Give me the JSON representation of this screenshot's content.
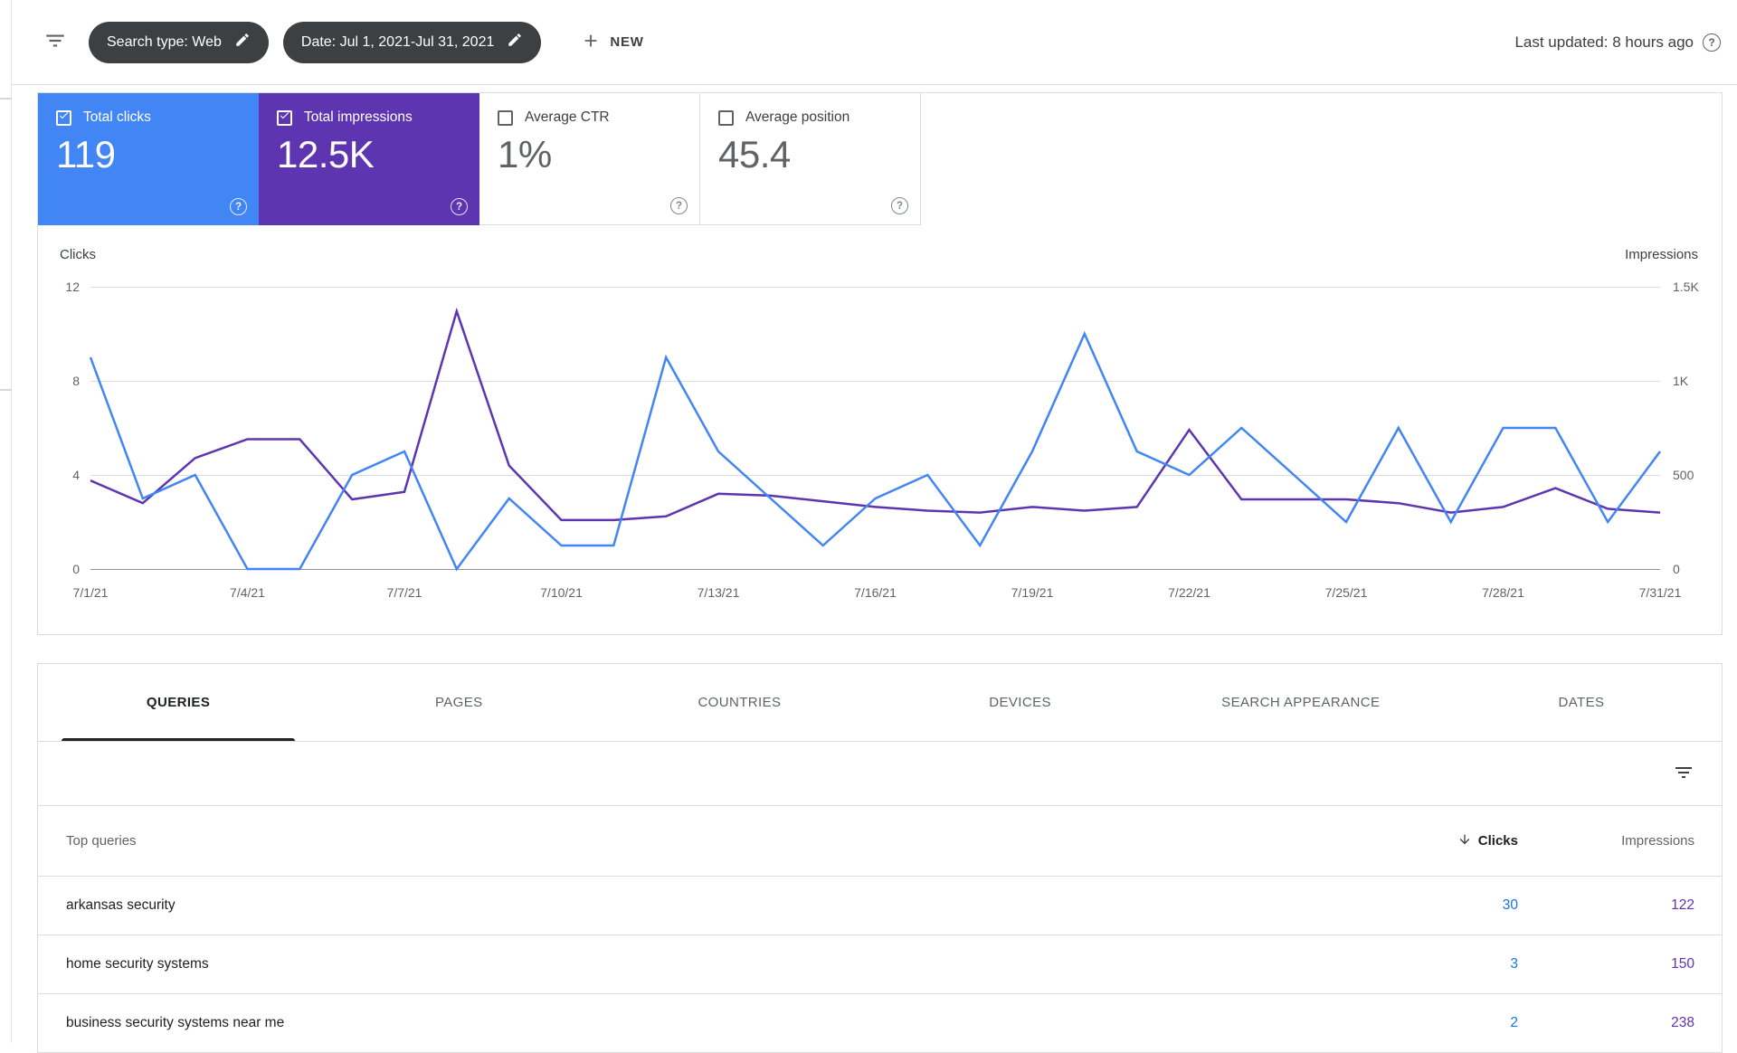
{
  "topbar": {
    "search_type_chip": "Search type: Web",
    "date_chip": "Date: Jul 1, 2021-Jul 31, 2021",
    "new_button_label": "NEW",
    "last_updated": "Last updated: 8 hours ago"
  },
  "icons": {
    "help_glyph": "?",
    "filter": "filter-list-icon",
    "edit": "pencil-icon",
    "add": "plus-icon",
    "sort": "arrow-down-icon",
    "checked": "checkmark-icon"
  },
  "colors": {
    "clicks_blue": "#4285f4",
    "impressions_purple": "#5e35b1",
    "link_blue": "#1a73e8",
    "chip_background": "#3c4043",
    "border_gray": "#dadce0"
  },
  "metric_cards": [
    {
      "label": "Total clicks",
      "value": "119",
      "selected": true
    },
    {
      "label": "Total impressions",
      "value": "12.5K",
      "selected": true
    },
    {
      "label": "Average CTR",
      "value": "1%",
      "selected": false
    },
    {
      "label": "Average position",
      "value": "45.4",
      "selected": false
    }
  ],
  "chart_data": {
    "type": "line",
    "x": [
      "7/1/21",
      "7/2/21",
      "7/3/21",
      "7/4/21",
      "7/5/21",
      "7/6/21",
      "7/7/21",
      "7/8/21",
      "7/9/21",
      "7/10/21",
      "7/11/21",
      "7/12/21",
      "7/13/21",
      "7/14/21",
      "7/15/21",
      "7/16/21",
      "7/17/21",
      "7/18/21",
      "7/19/21",
      "7/20/21",
      "7/21/21",
      "7/22/21",
      "7/23/21",
      "7/24/21",
      "7/25/21",
      "7/26/21",
      "7/27/21",
      "7/28/21",
      "7/29/21",
      "7/30/21",
      "7/31/21"
    ],
    "x_tick_every": 3,
    "series": [
      {
        "name": "Clicks",
        "color": "#4285f4",
        "axis": "left",
        "values": [
          9,
          3,
          4,
          0,
          0,
          4,
          5,
          0,
          3,
          1,
          1,
          9,
          5,
          3,
          1,
          3,
          4,
          1,
          5,
          10,
          5,
          4,
          6,
          4,
          2,
          6,
          2,
          6,
          6,
          2,
          5
        ]
      },
      {
        "name": "Impressions",
        "color": "#5e35b1",
        "axis": "right",
        "values": [
          470,
          350,
          590,
          690,
          690,
          370,
          410,
          1370,
          550,
          260,
          260,
          280,
          400,
          390,
          360,
          330,
          310,
          300,
          330,
          310,
          330,
          740,
          370,
          370,
          370,
          350,
          300,
          330,
          430,
          320,
          300
        ]
      }
    ],
    "left_axis": {
      "label": "Clicks",
      "max": 12,
      "ticks": [
        "12",
        "8",
        "4",
        "0"
      ]
    },
    "right_axis": {
      "label": "Impressions",
      "max": 1500,
      "ticks": [
        "1.5K",
        "1K",
        "500",
        "0"
      ]
    },
    "grid": true,
    "legend_position": "none"
  },
  "table": {
    "tabs": [
      "QUERIES",
      "PAGES",
      "COUNTRIES",
      "DEVICES",
      "SEARCH APPEARANCE",
      "DATES"
    ],
    "active_tab": "QUERIES",
    "header": {
      "dimension": "Top queries",
      "clicks": "Clicks",
      "impressions": "Impressions",
      "sorted_by": "Clicks",
      "sort_direction": "desc"
    },
    "rows": [
      {
        "query": "arkansas security",
        "clicks": "30",
        "impressions": "122"
      },
      {
        "query": "home security systems",
        "clicks": "3",
        "impressions": "150"
      },
      {
        "query": "business security systems near me",
        "clicks": "2",
        "impressions": "238"
      }
    ]
  }
}
